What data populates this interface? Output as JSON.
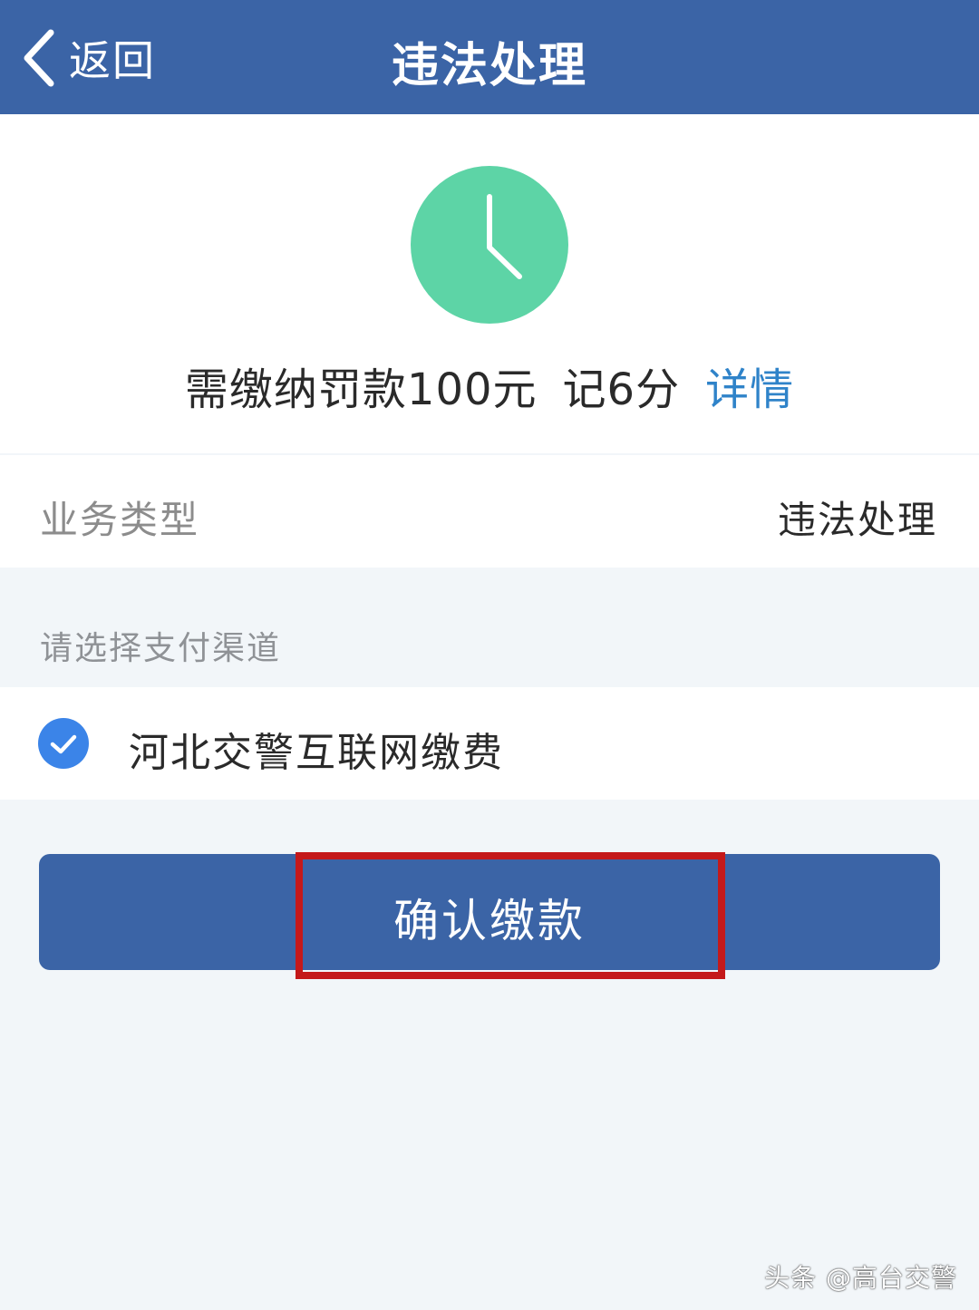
{
  "nav": {
    "back_label": "返回",
    "title": "违法处理"
  },
  "summary": {
    "icon": "clock-icon",
    "icon_color": "#5dd4a6",
    "fine_text": "需缴纳罚款100元",
    "points_text": "记6分",
    "details_link": "详情"
  },
  "business": {
    "label": "业务类型",
    "value": "违法处理"
  },
  "payment": {
    "header": "请选择支付渠道",
    "selected_channel": "河北交警互联网缴费",
    "selected": true
  },
  "confirm_button": {
    "label": "确认缴款"
  },
  "watermark": "头条 @高台交警",
  "colors": {
    "primary": "#3b64a6",
    "link": "#2f83c9",
    "check": "#3b84e8",
    "highlight": "#c4191a"
  }
}
